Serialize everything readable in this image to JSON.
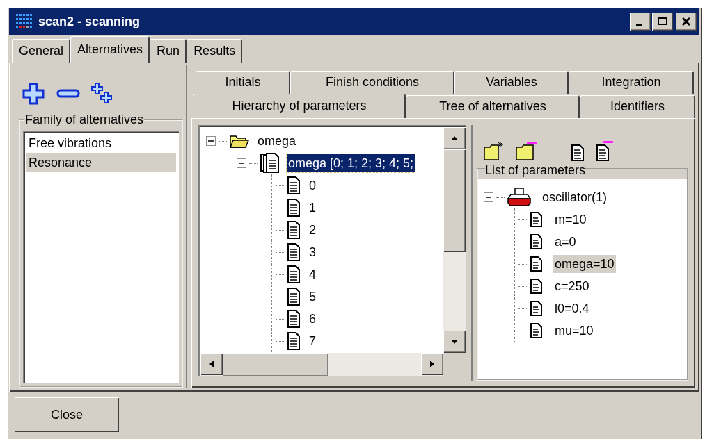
{
  "window": {
    "title": "scan2 - scanning"
  },
  "tabs": [
    {
      "label": "General",
      "selected": false
    },
    {
      "label": "Alternatives",
      "selected": true
    },
    {
      "label": "Run",
      "selected": false
    },
    {
      "label": "Results",
      "selected": false
    }
  ],
  "family_of_alternatives": {
    "title": "Family of alternatives",
    "items": [
      {
        "label": "Free vibrations",
        "selected": false
      },
      {
        "label": "Resonance",
        "selected": true
      }
    ]
  },
  "inner_tabs": {
    "back_row": [
      {
        "label": "Initials",
        "selected": false
      },
      {
        "label": "Finish conditions",
        "selected": false
      },
      {
        "label": "Variables",
        "selected": false
      },
      {
        "label": "Integration",
        "selected": false
      }
    ],
    "front_row": [
      {
        "label": "Hierarchy of parameters",
        "selected": true
      },
      {
        "label": "Tree of alternatives",
        "selected": false
      },
      {
        "label": "Identifiers",
        "selected": false
      }
    ]
  },
  "hierarchy_tree": [
    {
      "kind": "folder",
      "label": "omega",
      "expanded": true,
      "selected": false,
      "children": [
        {
          "kind": "set",
          "label": "omega [0; 1; 2; 3; 4; 5;",
          "expanded": true,
          "selected": true,
          "children": [
            {
              "kind": "document",
              "label": "0",
              "selected": false
            },
            {
              "kind": "document",
              "label": "1",
              "selected": false
            },
            {
              "kind": "document",
              "label": "2",
              "selected": false
            },
            {
              "kind": "document",
              "label": "3",
              "selected": false
            },
            {
              "kind": "document",
              "label": "4",
              "selected": false
            },
            {
              "kind": "document",
              "label": "5",
              "selected": false
            },
            {
              "kind": "document",
              "label": "6",
              "selected": false
            },
            {
              "kind": "document",
              "label": "7",
              "selected": false
            }
          ]
        }
      ]
    }
  ],
  "parameters": {
    "title": "List of parameters",
    "tree": [
      {
        "kind": "device",
        "label": "oscillator(1)",
        "expanded": true,
        "selected": false,
        "children": [
          {
            "kind": "document",
            "label": "m=10",
            "selected": false
          },
          {
            "kind": "document",
            "label": "a=0",
            "selected": false
          },
          {
            "kind": "document",
            "label": "omega=10",
            "selected": true
          },
          {
            "kind": "document",
            "label": "c=250",
            "selected": false
          },
          {
            "kind": "document",
            "label": "l0=0.4",
            "selected": false
          },
          {
            "kind": "document",
            "label": "mu=10",
            "selected": false
          }
        ]
      }
    ]
  },
  "buttons": [
    {
      "label": "Close"
    }
  ]
}
